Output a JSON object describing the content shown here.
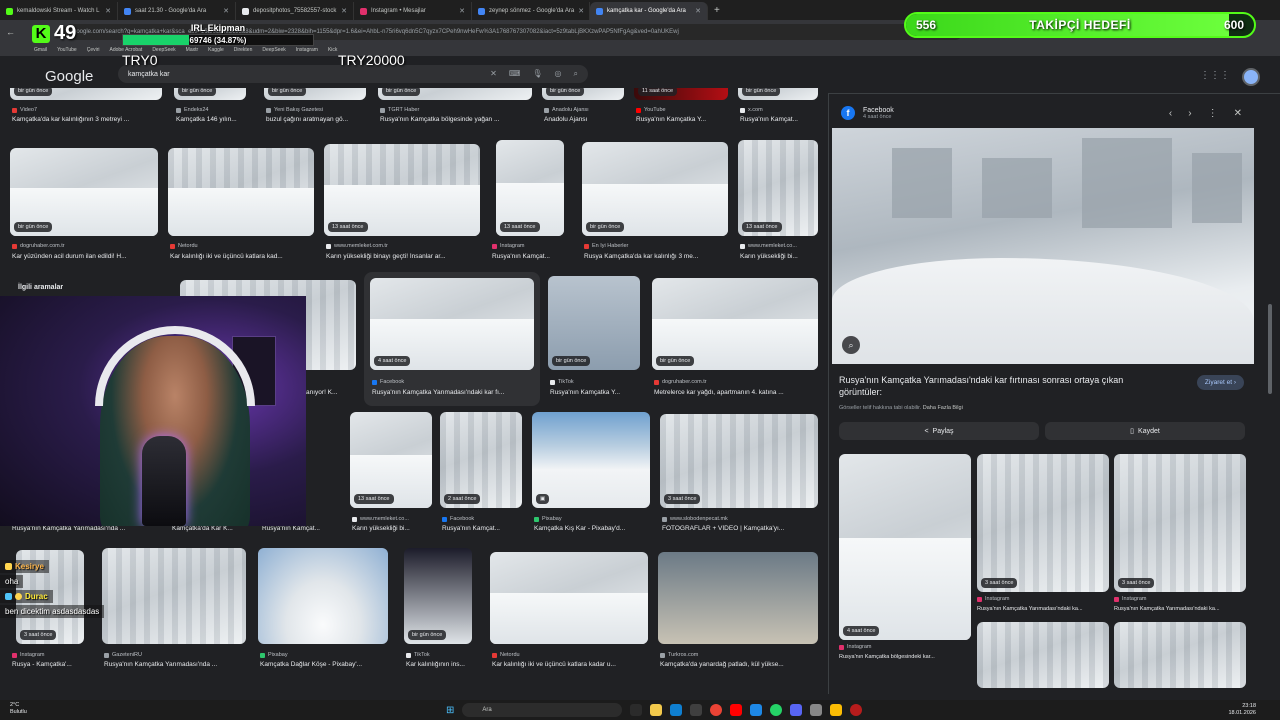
{
  "tabs": [
    {
      "label": "kemaldowski Stream - Watch L",
      "color": "#53fc18"
    },
    {
      "label": "saat 21.30 - Google'da Ara",
      "color": "#4285f4"
    },
    {
      "label": "depositphotos_75582557-stock",
      "color": "#e8eaed"
    },
    {
      "label": "Instagram • Mesajlar",
      "color": "#e1306c"
    },
    {
      "label": "zeynep sönmez - Google'da Ara",
      "color": "#4285f4"
    },
    {
      "label": "kamçatka kar - Google'da Ara",
      "color": "#4285f4"
    }
  ],
  "url": "google.com/search?q=kamçatka+kar&sca_esv=16af0ce4e3c93a8&udm=2&biw=2328&bih=1155&dpr=1.6&ei=AhbL-n75ri6vq6dn5C7qyzx7CPeh9nwHeFw%3A1768767307082&iact=5z9tabLjBKXzwPAP5NfFgAg&ved=0ahUKEwj",
  "bookmarks": [
    "Gmail",
    "YouTube",
    "Çeviri",
    "Adobe Acrobat",
    "DeepSeek",
    "Maxtr",
    "Kaggle",
    "Direkten",
    "DeepSeek",
    "Instagram",
    "Kick"
  ],
  "google": {
    "logo": "Google",
    "query": "kamçatka kar"
  },
  "overlay": {
    "kick_count": "49",
    "irl_title": "IRL Ekipman",
    "irl_label": "69746 (34.87%)",
    "irl_progress": 0.3487,
    "try_left": "TRY0",
    "try_right": "TRY20000",
    "follow_left": "556",
    "follow_title": "TAKİPÇİ HEDEFİ",
    "follow_right": "600",
    "follow_progress": 0.927
  },
  "related": "İlgili aramalar",
  "row0": [
    {
      "badge": "bir gün önce",
      "src": "Video7",
      "title": "Kamçatka'da kar kalınlığının 3 metreyi ..."
    },
    {
      "badge": "bir gün önce",
      "src": "Endeks24",
      "title": "Kamçatka 146 yılın..."
    },
    {
      "badge": "bir gün önce",
      "src": "Yeni Bakış Gazetesi",
      "title": "buzul çağını aratmayan gö..."
    },
    {
      "badge": "bir gün önce",
      "src": "TGRT Haber",
      "title": "Rusya'nın Kamçatka bölgesinde yağan ..."
    },
    {
      "badge": "bir gün önce",
      "src": "Anadolu Ajansı",
      "title": "Anadolu Ajansı"
    },
    {
      "badge": "11 saat önce",
      "src": "YouTube",
      "title": "Rusya'nın Kamçatka Y..."
    },
    {
      "badge": "bir gün önce",
      "src": "x.com",
      "title": "Rusya'nın Kamçat..."
    }
  ],
  "row1": [
    {
      "badge": "bir gün önce",
      "src": "dogruhaber.com.tr",
      "title": "Kar yüzünden acil durum ilan edildi! H..."
    },
    {
      "badge": "",
      "src": "Netordu",
      "title": "Kar kalınlığı iki ve üçüncü katlara kad..."
    },
    {
      "badge": "13 saat önce",
      "src": "www.memleket.com.tr",
      "title": "Karın yüksekliği binayı geçti! İnsanlar ar..."
    },
    {
      "badge": "13 saat önce",
      "src": "Instagram",
      "title": "Rusya'nın Kamçat..."
    },
    {
      "badge": "bir gün önce",
      "src": "En İyi Haberler",
      "title": "Rusya Kamçatka'da kar kalınlığı 3 me..."
    },
    {
      "badge": "13 saat önce",
      "src": "www.memleket.co...",
      "title": "Karın yüksekliği bi..."
    }
  ],
  "row2": [
    {
      "badge": "",
      "src": "",
      "title": "anıyor! K..."
    },
    {
      "badge": "4 saat önce",
      "src": "Facebook",
      "title": "Rusya'nın Kamçatka Yarımadası'ndaki kar fı..."
    },
    {
      "badge": "bir gün önce",
      "src": "TikTok",
      "title": "Rusya'nın Kamçatka Y..."
    },
    {
      "badge": "bir gün önce",
      "src": "dogruhaber.com.tr",
      "title": "Metrelerce kar yağdı, apartmanın 4. katına ..."
    }
  ],
  "row3": [
    {
      "badge": "",
      "src": "",
      "title": "Rusya'nın Kamçatka Yarımadası'nda ..."
    },
    {
      "badge": "",
      "src": "",
      "title": "Kamçatka'da Kar K..."
    },
    {
      "badge": "",
      "src": "",
      "title": "Rusya'nın Kamçat..."
    },
    {
      "badge": "13 saat önce",
      "src": "www.memleket.co...",
      "title": "Karın yüksekliği bi..."
    },
    {
      "badge": "2 saat önce",
      "src": "Facebook",
      "title": "Rusya'nın Kamçat..."
    },
    {
      "badge": "",
      "src": "Pixabay",
      "title": "Kamçatka Kış Kar - Pixabay'd..."
    },
    {
      "badge": "3 saat önce",
      "src": "www.slobodenpecat.mk",
      "title": "FOTOĞRAFLAR + VİDEO | Kamçatka'yı..."
    }
  ],
  "row4": [
    {
      "badge": "3 saat önce",
      "src": "Instagram",
      "title": "Rusya - Kamçatka'..."
    },
    {
      "badge": "",
      "src": "GazeteniRU",
      "title": "Rusya'nın Kamçatka Yarımadası'nda ..."
    },
    {
      "badge": "",
      "src": "Pixabay",
      "title": "Kamçatka Dağlar Köşe - Pixabay'..."
    },
    {
      "badge": "bir gün önce",
      "src": "TikTok",
      "title": "Kar kalınlığının ins..."
    },
    {
      "badge": "bir gün önce",
      "src": "Netordu",
      "title": "Kar kalınlığı iki ve üçüncü katlara kadar u..."
    },
    {
      "badge": "",
      "src": "Turkros.com",
      "title": "Kamçatka'da yanardağ patladı, kül yükse..."
    }
  ],
  "panel": {
    "source": "Facebook",
    "age": "4 saat önce",
    "title": "Rusya'nın Kamçatka Yarımadası'ndaki kar fırtınası sonrası ortaya çıkan görüntüler:",
    "visit": "Ziyaret et",
    "copyright": "Görseller telif hakkına tabi olabilir.",
    "more": "Daha Fazla Bilgi",
    "share": "Paylaş",
    "save": "Kaydet",
    "related": [
      {
        "badge": "4 saat önce",
        "src": "Instagram",
        "title": "Rusya'nın Kamçatka bölgesindeki kar..."
      },
      {
        "badge": "3 saat önce",
        "src": "Instagram",
        "title": "Rusya'nın Kamçatka Yarımadası'ndaki ka..."
      },
      {
        "badge": "3 saat önce",
        "src": "Instagram",
        "title": "Rusya'nın Kamçatka Yarımadası'ndaki ka..."
      }
    ]
  },
  "chat": [
    {
      "user": "Kesirye",
      "msg": ""
    },
    {
      "user": "",
      "msg": "oha"
    },
    {
      "user": "Durac",
      "msg": ""
    },
    {
      "user": "",
      "msg": "ben dicektim asdasdasdas"
    }
  ],
  "taskbar": {
    "weather_temp": "2°C",
    "weather_desc": "Bulutlu",
    "search": "Ara",
    "time": "23:18",
    "date": "18.01.2026"
  }
}
